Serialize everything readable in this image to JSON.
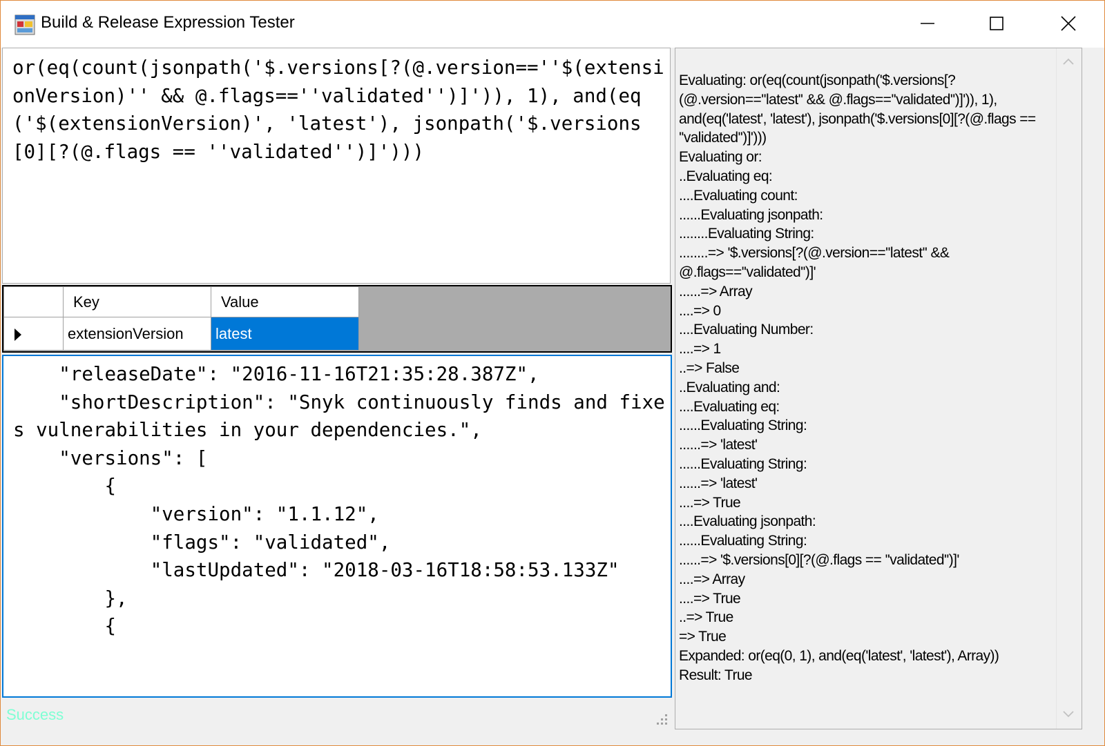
{
  "window": {
    "title": "Build & Release Expression Tester",
    "app_icon": "app-window-icon",
    "controls": [
      "minimize-icon",
      "maximize-icon",
      "close-icon"
    ]
  },
  "expression": {
    "text": "or(eq(count(jsonpath('$.versions[?(@.version==''$(extensionVersion)'' && @.flags==''validated'')]')), 1), and(eq('$(extensionVersion)', 'latest'), jsonpath('$.versions[0][?(@.flags == ''validated'')]')))"
  },
  "variables": {
    "columns": [
      "Key",
      "Value"
    ],
    "rows": [
      {
        "key": "extensionVersion",
        "value": "latest"
      }
    ]
  },
  "json_input": {
    "text": "    \"releaseDate\": \"2016-11-16T21:35:28.387Z\",\n    \"shortDescription\": \"Snyk continuously finds and fixes vulnerabilities in your dependencies.\",\n    \"versions\": [\n        {\n            \"version\": \"1.1.12\",\n            \"flags\": \"validated\",\n            \"lastUpdated\": \"2018-03-16T18:58:53.133Z\"\n        },\n        {"
  },
  "status": {
    "text": "Success",
    "color": "#7fffd4"
  },
  "output": {
    "lines": [
      "Evaluating: or(eq(count(jsonpath('$.versions[?(@.version==''latest'' && @.flags==''validated'')]')), 1), and(eq('latest', 'latest'), jsonpath('$.versions[0][?(@.flags == ''validated'')]')))",
      "Evaluating or:",
      "..Evaluating eq:",
      "....Evaluating count:",
      "......Evaluating jsonpath:",
      "........Evaluating String:",
      "........=> '$.versions[?(@.version==''latest'' && @.flags==''validated'')]'",
      "......=> Array",
      "....=> 0",
      "....Evaluating Number:",
      "....=> 1",
      "..=> False",
      "..Evaluating and:",
      "....Evaluating eq:",
      "......Evaluating String:",
      "......=> 'latest'",
      "......Evaluating String:",
      "......=> 'latest'",
      "....=> True",
      "....Evaluating jsonpath:",
      "......Evaluating String:",
      "......=> '$.versions[0][?(@.flags == ''validated'')]'",
      "....=> Array",
      "....=> True",
      "..=> True",
      "=> True",
      "Expanded: or(eq(0, 1), and(eq('latest', 'latest'), Array))",
      "Result: True"
    ]
  },
  "colors": {
    "selection": "#0078d7",
    "window_border": "#e08a3c",
    "focus_border": "#0078d7"
  }
}
